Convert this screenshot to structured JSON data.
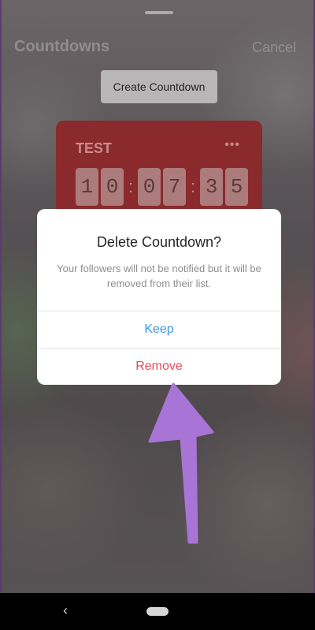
{
  "header": {
    "title": "Countdowns",
    "cancel_label": "Cancel"
  },
  "create_button": {
    "label": "Create Countdown"
  },
  "countdown_card": {
    "name": "TEST",
    "menu_glyph": "•••",
    "digits": [
      "1",
      "0",
      "0",
      "7",
      "3",
      "5"
    ],
    "separator": ":",
    "color": "#8a2a2c"
  },
  "dialog": {
    "title": "Delete Countdown?",
    "message": "Your followers will not be notified but it will be removed from their list.",
    "keep_label": "Keep",
    "remove_label": "Remove",
    "keep_color": "#3897f0",
    "remove_color": "#ed4956"
  },
  "annotation": {
    "arrow_color": "#a874d6",
    "icon": "arrow-up-icon"
  },
  "navbar": {
    "back_glyph": "‹",
    "back_icon": "back-icon",
    "home_icon": "home-pill-icon"
  }
}
